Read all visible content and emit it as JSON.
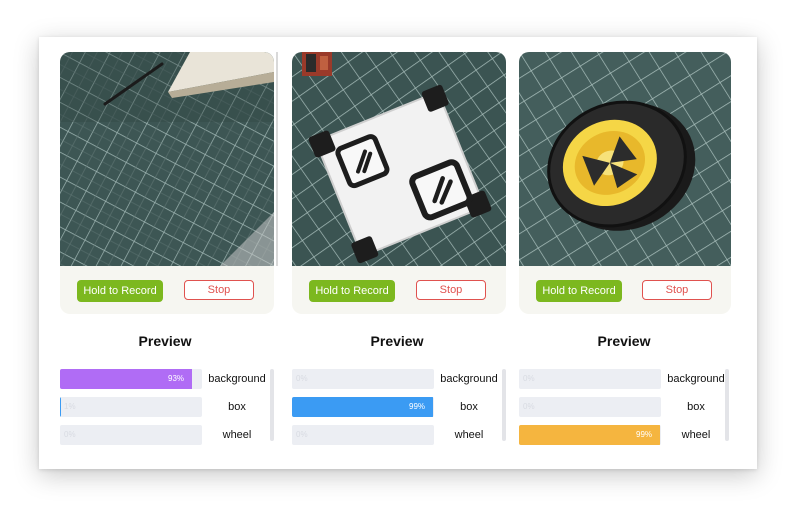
{
  "panels": [
    {
      "record_label": "Hold to Record",
      "stop_label": "Stop",
      "preview_title": "Preview",
      "classes": [
        {
          "label": "background",
          "percent": 93,
          "percent_text": "93%",
          "color": "#b06cf5"
        },
        {
          "label": "box",
          "percent": 1,
          "percent_text": "1%",
          "color": "#3b9bf3"
        },
        {
          "label": "wheel",
          "percent": 0,
          "percent_text": "0%",
          "color": "#f5b53f"
        }
      ]
    },
    {
      "record_label": "Hold to Record",
      "stop_label": "Stop",
      "preview_title": "Preview",
      "classes": [
        {
          "label": "background",
          "percent": 0,
          "percent_text": "0%",
          "color": "#b06cf5"
        },
        {
          "label": "box",
          "percent": 99,
          "percent_text": "99%",
          "color": "#3b9bf3"
        },
        {
          "label": "wheel",
          "percent": 0,
          "percent_text": "0%",
          "color": "#f5b53f"
        }
      ]
    },
    {
      "record_label": "Hold to Record",
      "stop_label": "Stop",
      "preview_title": "Preview",
      "classes": [
        {
          "label": "background",
          "percent": 0,
          "percent_text": "0%",
          "color": "#b06cf5"
        },
        {
          "label": "box",
          "percent": 0,
          "percent_text": "0%",
          "color": "#3b9bf3"
        },
        {
          "label": "wheel",
          "percent": 99,
          "percent_text": "99%",
          "color": "#f5b53f"
        }
      ]
    }
  ],
  "colors": {
    "record_button": "#7cb81f",
    "stop_button": "#e0524f",
    "track": "#eceef3",
    "camera_mat": "#3e5855"
  }
}
